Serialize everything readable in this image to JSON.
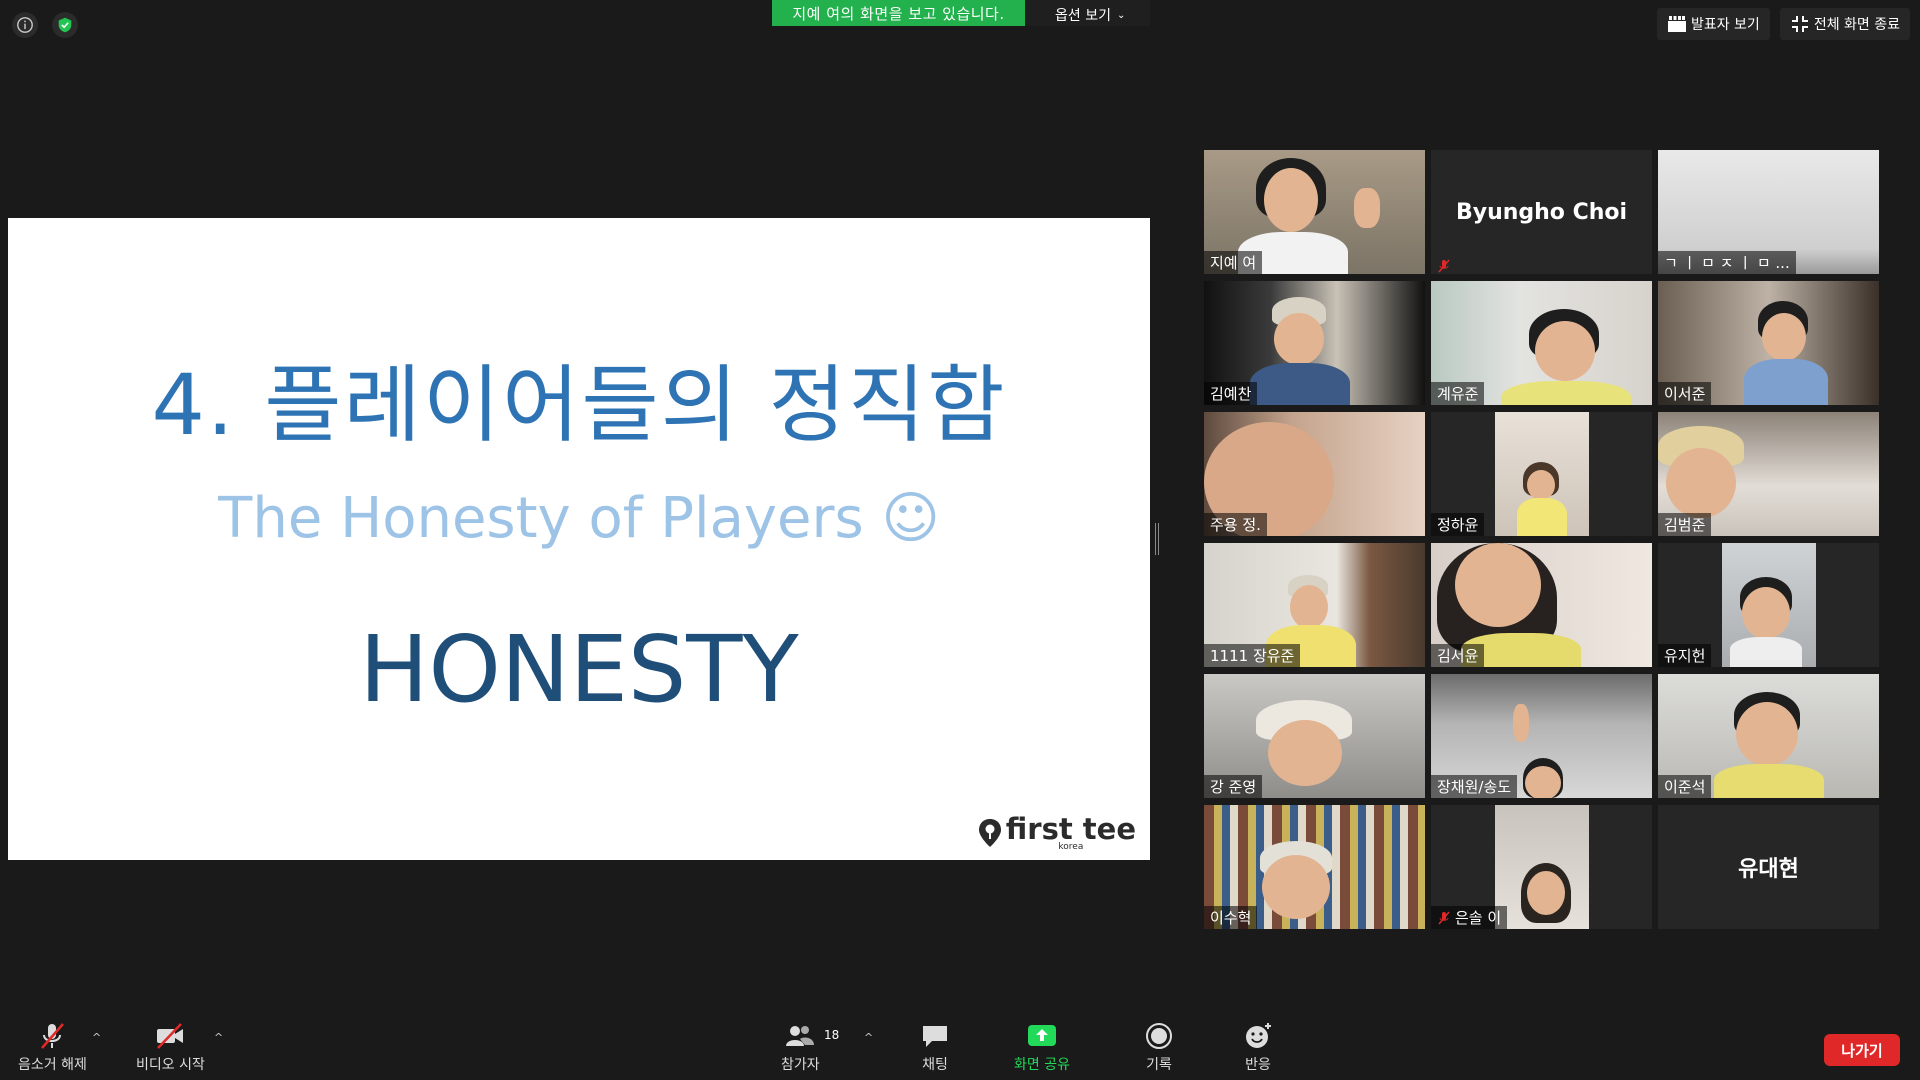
{
  "top": {
    "sharing_banner": "지예 여의 화면을 보고 있습니다.",
    "view_options": "옵션 보기",
    "speaker_view": "발표자 보기",
    "exit_fullscreen": "전체 화면 종료"
  },
  "slide": {
    "title": "4. 플레이어들의 정직함",
    "subtitle": "The Honesty of Players ☺",
    "big": "HONESTY",
    "logo_text": "first tee",
    "logo_sub": "korea"
  },
  "participants": [
    {
      "name": "지예 여",
      "video": true,
      "muted": false
    },
    {
      "name": "Byungho Choi",
      "video": false,
      "muted": true
    },
    {
      "name": "ㄱ ㅣ ㅁ ㅈ ㅣ ㅁ ...",
      "video": true,
      "muted": false
    },
    {
      "name": "김예찬",
      "video": true,
      "muted": false
    },
    {
      "name": "계유준",
      "video": true,
      "muted": false
    },
    {
      "name": "이서준",
      "video": true,
      "muted": false
    },
    {
      "name": "주용 정.",
      "video": true,
      "muted": false
    },
    {
      "name": "정하윤",
      "video": true,
      "muted": false
    },
    {
      "name": "김범준",
      "video": true,
      "muted": false
    },
    {
      "name": "1111 장유준",
      "video": true,
      "muted": false
    },
    {
      "name": "김서윤",
      "video": true,
      "muted": false
    },
    {
      "name": "유지헌",
      "video": true,
      "muted": false
    },
    {
      "name": "강 준영",
      "video": true,
      "muted": false
    },
    {
      "name": "장채원/송도",
      "video": true,
      "muted": false,
      "active": true
    },
    {
      "name": "이준석",
      "video": true,
      "muted": false
    },
    {
      "name": "이수혁",
      "video": true,
      "muted": false
    },
    {
      "name": "은솔 이",
      "video": true,
      "muted": true
    },
    {
      "name": "유대현",
      "video": false,
      "muted": false
    }
  ],
  "toolbar": {
    "unmute": "음소거 해제",
    "start_video": "비디오 시작",
    "participants": "참가자",
    "participant_count": "18",
    "chat": "채팅",
    "share_screen": "화면 공유",
    "record": "기록",
    "reactions": "반응",
    "leave": "나가기"
  },
  "colors": {
    "banner_green": "#22b14c",
    "leave_red": "#e02828",
    "active_speaker": "#c9e265",
    "title_blue": "#2e74b5"
  }
}
